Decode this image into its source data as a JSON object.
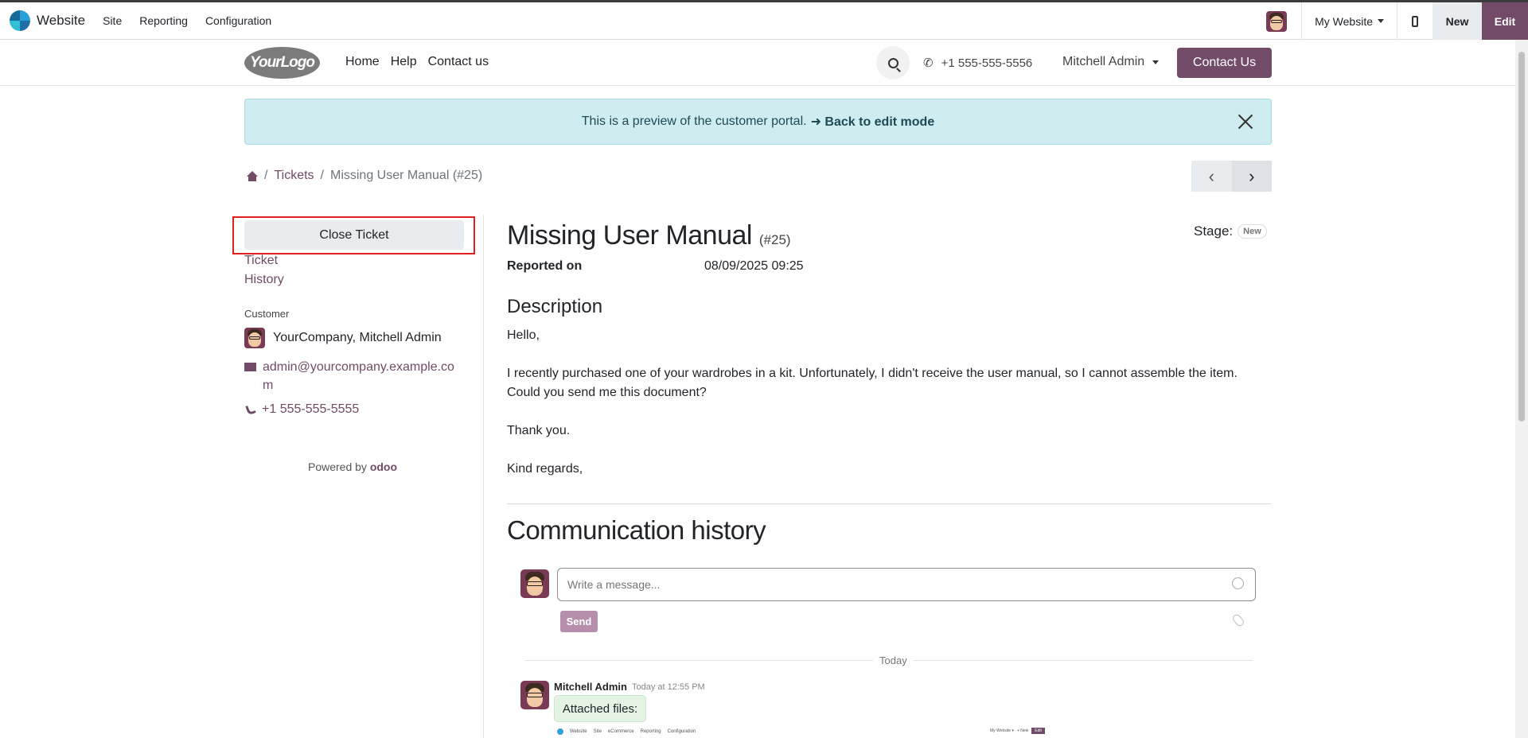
{
  "admin_bar": {
    "app_name": "Website",
    "menus": [
      "Site",
      "Reporting",
      "Configuration"
    ],
    "website_selector": "My Website",
    "new_label": "New",
    "edit_label": "Edit"
  },
  "header": {
    "logo_text": "YourLogo",
    "nav": [
      "Home",
      "Help",
      "Contact us"
    ],
    "phone": "+1 555-555-5556",
    "user": "Mitchell Admin",
    "contact_button": "Contact Us"
  },
  "alert": {
    "text": "This is a preview of the customer portal.",
    "link": "➜ Back to edit mode"
  },
  "breadcrumb": {
    "items": [
      "Tickets",
      "Missing User Manual (#25)"
    ],
    "sep": "/"
  },
  "pager": {
    "prev": "‹",
    "next": "›"
  },
  "sidebar": {
    "close_ticket": "Close Ticket",
    "links": [
      "Ticket",
      "History"
    ],
    "customer_label": "Customer",
    "customer_name": "YourCompany, Mitchell Admin",
    "email": "admin@yourcompany.example.com",
    "phone": "+1 555-555-5555",
    "powered_by": "Powered by",
    "powered_brand": "odoo"
  },
  "ticket": {
    "title": "Missing User Manual",
    "number": "(#25)",
    "stage_label": "Stage:",
    "stage_value": "New",
    "reported_label": "Reported on",
    "reported_date": "08/09/2025 09:25",
    "description_heading": "Description",
    "description": [
      "Hello,",
      "I recently purchased one of your wardrobes in a kit. Unfortunately, I didn't receive the user manual, so I cannot assemble the item. Could you send me this document?",
      "Thank you.",
      "Kind regards,"
    ]
  },
  "communication": {
    "heading": "Communication history",
    "placeholder": "Write a message...",
    "send_label": "Send",
    "today_label": "Today",
    "message": {
      "author": "Mitchell Admin",
      "time": "Today at 12:55 PM",
      "body": "Attached files:"
    },
    "mini_preview": {
      "app": "Website",
      "menus": [
        "Site",
        "eCommerce",
        "Reporting",
        "Configuration"
      ],
      "right": [
        "My Website ▾",
        "+ New",
        "Edit"
      ]
    }
  }
}
